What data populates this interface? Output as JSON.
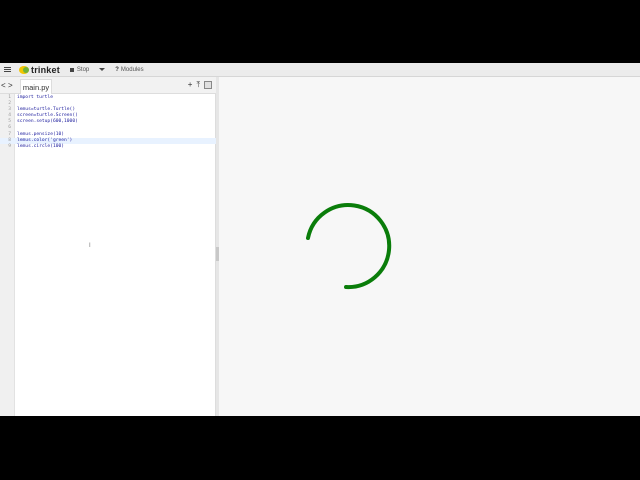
{
  "toolbar": {
    "menu_icon": "hamburger-icon",
    "logo_text": "trinket",
    "stop_label": "Stop",
    "modules_label": "Modules",
    "help_icon": "?"
  },
  "editor": {
    "back_arrow": "<",
    "forward_arrow": ">",
    "file_tab": "main.py",
    "actions": {
      "add": "+",
      "upload": "upload-icon",
      "image": "image-icon"
    },
    "lines": [
      {
        "n": "1",
        "text": "import turtle"
      },
      {
        "n": "2",
        "text": ""
      },
      {
        "n": "3",
        "text": "lemus=turtle.Turtle()"
      },
      {
        "n": "4",
        "text": "screen=turtle.Screen()"
      },
      {
        "n": "5",
        "text": "screen.setup(600,1000)"
      },
      {
        "n": "6",
        "text": ""
      },
      {
        "n": "7",
        "text": "lemus.pensize(10)"
      },
      {
        "n": "8",
        "text": "lemus.color('green')"
      },
      {
        "n": "9",
        "text": "lemus.circle(100)"
      }
    ],
    "active_line": "8"
  },
  "output": {
    "stroke_color": "#0a7d0a",
    "arc_description": "partial circle drawn by turtle"
  }
}
